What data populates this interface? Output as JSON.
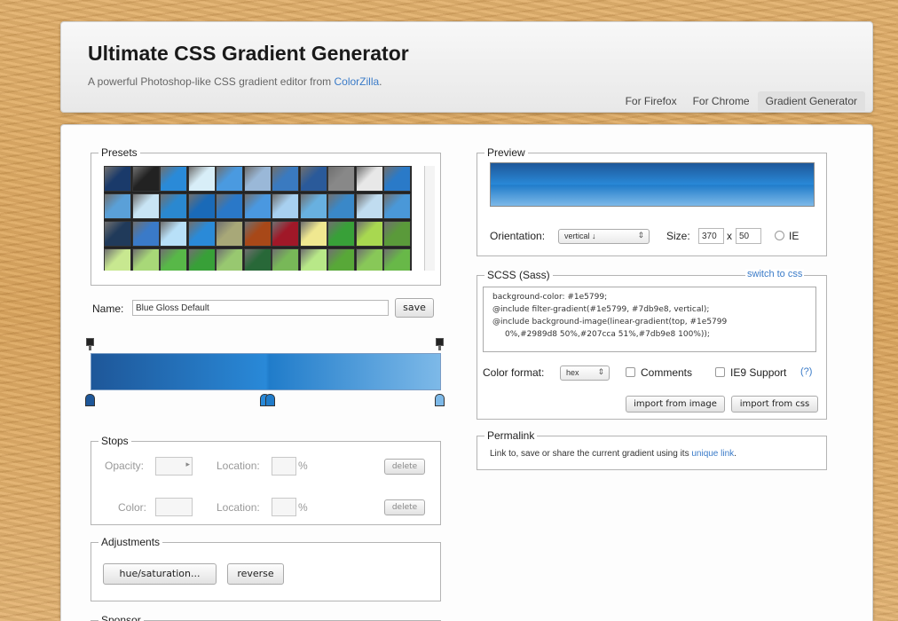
{
  "header": {
    "title": "Ultimate CSS Gradient Generator",
    "subtitle_prefix": "A powerful Photoshop-like CSS gradient editor from ",
    "subtitle_link": "ColorZilla",
    "subtitle_suffix": ".",
    "tabs": [
      {
        "label": "For Firefox",
        "active": false
      },
      {
        "label": "For Chrome",
        "active": false
      },
      {
        "label": "Gradient Generator",
        "active": true
      }
    ]
  },
  "presets": {
    "legend": "Presets",
    "swatches": [
      [
        "#1a3a6a",
        "#222222",
        "#2a8ad8",
        "#d8eef8",
        "#4a9ae0",
        "#9ab8d8",
        "#3a7ac0",
        "#2a5a9a",
        "#888888",
        "#e8e8e8",
        "#2a7ac8"
      ],
      [
        "#5aa0d8",
        "#c8e4f4",
        "#2a88d0",
        "#1a6ab8",
        "#2a78c8",
        "#4a98e0",
        "#a8d0f0",
        "#68b0e0",
        "#3a88c8",
        "#c0dcf0",
        "#4a98d8"
      ],
      [
        "#203a5a",
        "#3a7ac8",
        "#b8e0f8",
        "#2a8ad8",
        "#a8a878",
        "#a84818",
        "#a01828",
        "#f0e890",
        "#38a038",
        "#a8d850",
        "#5a9a3a"
      ],
      [
        "#c8e890",
        "#a8d878",
        "#58b848",
        "#38a038",
        "#98c870",
        "#286838",
        "#78b858",
        "#b8e888",
        "#58a838",
        "#88c858",
        "#68b848"
      ]
    ]
  },
  "name_field": {
    "label": "Name:",
    "value": "Blue Gloss Default",
    "save": "save"
  },
  "gradient": {
    "colors": [
      "#1e5799",
      "#2989d8",
      "#207cca",
      "#7db9e8"
    ]
  },
  "stops": {
    "legend": "Stops",
    "opacity_label": "Opacity:",
    "location_label": "Location:",
    "percent": "%",
    "delete": "delete",
    "color_label": "Color:"
  },
  "adjustments": {
    "legend": "Adjustments",
    "hue": "hue/saturation...",
    "reverse": "reverse"
  },
  "sponsor": {
    "legend": "Sponsor"
  },
  "preview": {
    "legend": "Preview",
    "orientation_label": "Orientation:",
    "orientation_value": "vertical ↓",
    "size_label": "Size:",
    "width": "370",
    "x": "x",
    "height": "50",
    "ie_label": "IE"
  },
  "scss": {
    "legend": "SCSS (Sass)",
    "switch": "switch to css",
    "code": [
      "background-color: #1e5799;",
      "@include filter-gradient(#1e5799, #7db9e8, vertical);",
      "@include background-image(linear-gradient(top, #1e5799",
      "0%,#2989d8 50%,#207cca 51%,#7db9e8 100%));"
    ],
    "format_label": "Color format:",
    "format_value": "hex",
    "comments": "Comments",
    "ie9": "IE9 Support",
    "help": "(?)",
    "import_image": "import from image",
    "import_css": "import from css"
  },
  "permalink": {
    "legend": "Permalink",
    "text": "Link to, save or share the current gradient using its ",
    "link": "unique link",
    "suffix": "."
  }
}
